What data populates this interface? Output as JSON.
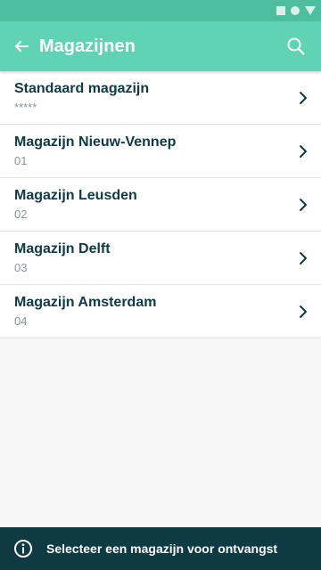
{
  "status_bar": {
    "icons": [
      "square-icon",
      "circle-icon",
      "triangle-icon"
    ]
  },
  "header": {
    "title": "Magazijnen",
    "back_icon": "arrow-left-icon",
    "search_icon": "search-icon"
  },
  "warehouses": [
    {
      "name": "Standaard magazijn",
      "code": "*****"
    },
    {
      "name": "Magazijn Nieuw-Vennep",
      "code": "01"
    },
    {
      "name": "Magazijn Leusden",
      "code": "02"
    },
    {
      "name": "Magazijn Delft",
      "code": "03"
    },
    {
      "name": "Magazijn Amsterdam",
      "code": "04"
    }
  ],
  "footer": {
    "icon": "info-icon",
    "message": "Selecteer een magazijn voor ontvangst"
  },
  "colors": {
    "status_bar": "#4dbfa0",
    "app_bar": "#5fd3b3",
    "text_primary": "#0e3b43",
    "text_secondary": "#8a9599",
    "footer_bg": "#0e3b43"
  }
}
